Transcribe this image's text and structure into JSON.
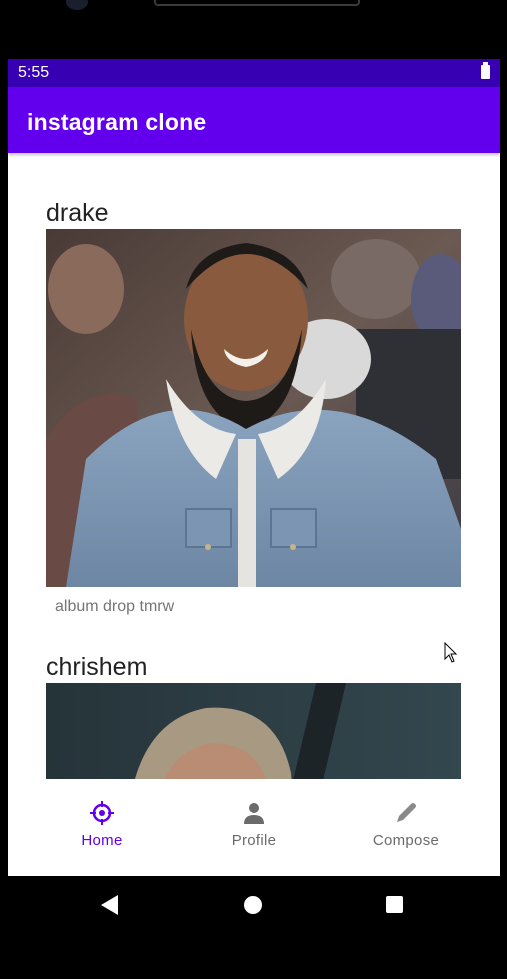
{
  "status_bar": {
    "time": "5:55"
  },
  "app_bar": {
    "title": "instagram clone"
  },
  "posts": [
    {
      "username": "drake",
      "caption": "album drop tmrw"
    },
    {
      "username": "chrishem",
      "caption": ""
    }
  ],
  "bottom_nav": {
    "items": [
      {
        "label": "Home",
        "icon": "compass-icon",
        "active": true
      },
      {
        "label": "Profile",
        "icon": "person-icon",
        "active": false
      },
      {
        "label": "Compose",
        "icon": "pencil-icon",
        "active": false
      }
    ]
  },
  "colors": {
    "status_bar": "#3700b3",
    "app_bar": "#6200ee",
    "active_nav": "#6200ee"
  }
}
